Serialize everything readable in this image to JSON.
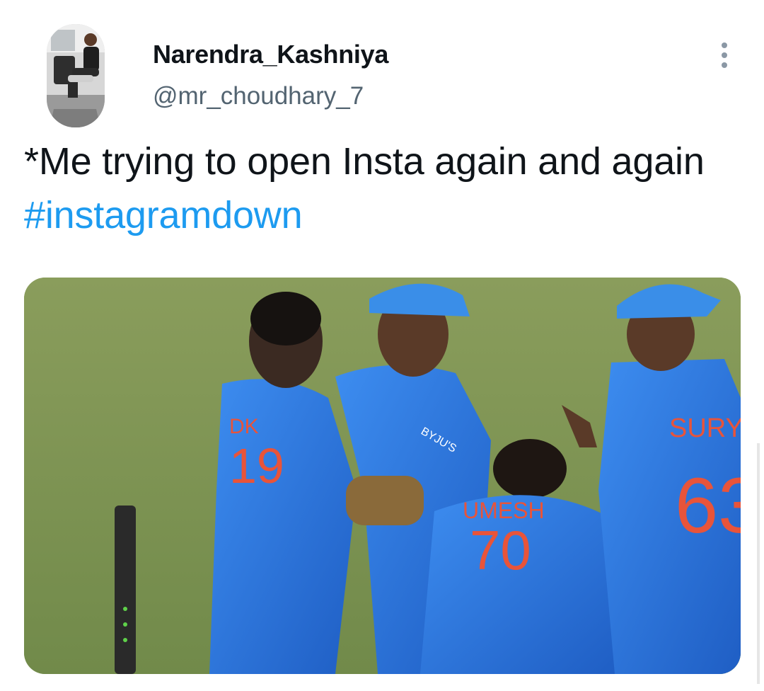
{
  "tweet": {
    "author": {
      "display_name": "Narendra_Kashniya",
      "handle": "@mr_choudhary_7",
      "avatar_icon": "profile-photo"
    },
    "more_icon": "vertical-ellipsis-icon",
    "text_prefix": "*Me trying to open Insta again and again ",
    "hashtag": "#instagramdown",
    "media": {
      "jerseys": [
        {
          "name": "DK",
          "number": "19"
        },
        {
          "name": "UMESH",
          "number": "70"
        },
        {
          "name": "SURYA",
          "number": "63"
        }
      ],
      "sponsor": "BYJU'S"
    }
  },
  "colors": {
    "text": "#0f1419",
    "secondary": "#536471",
    "link": "#1d9bf0",
    "jersey_blue": "#2b6fd6",
    "jersey_number": "#e8543a",
    "pitch_green": "#7f9554"
  }
}
